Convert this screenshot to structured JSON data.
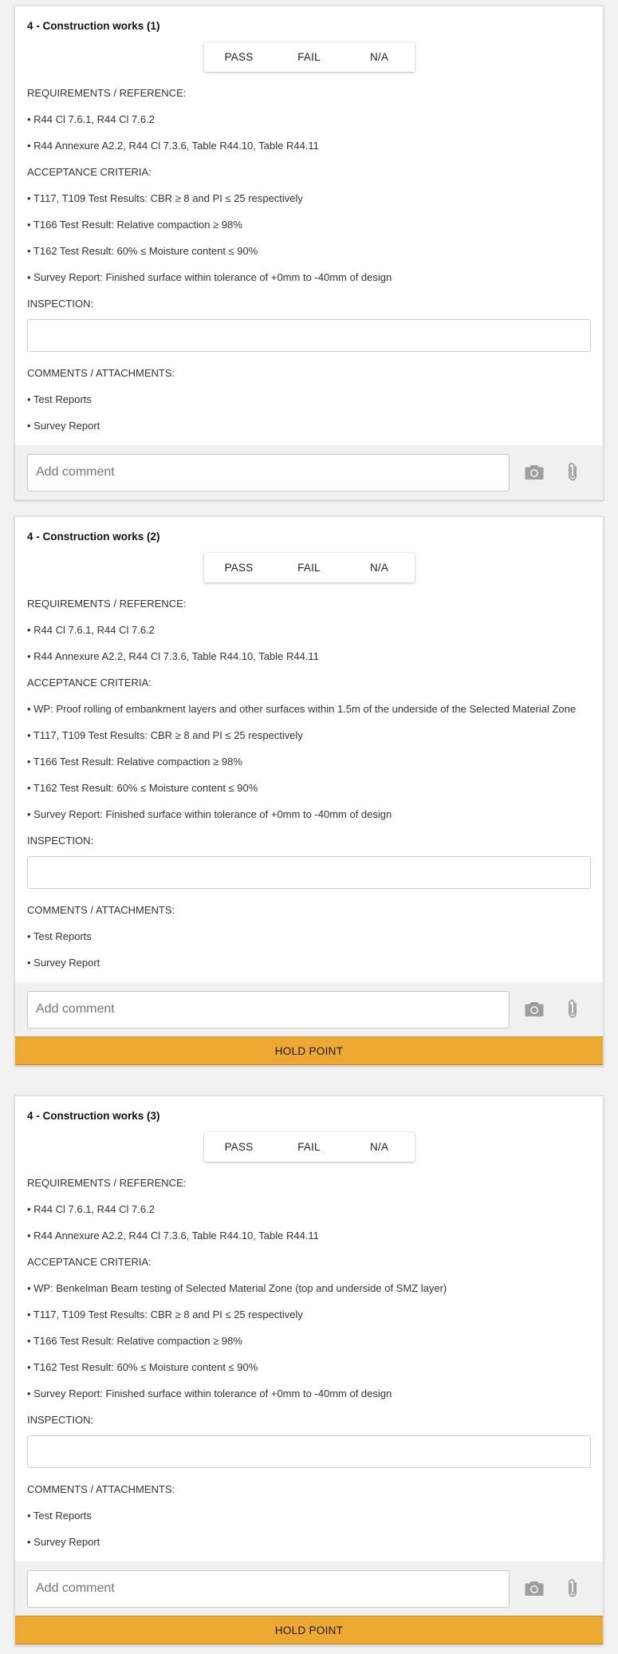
{
  "cards": [
    {
      "title": "4 - Construction works (1)",
      "options": [
        "PASS",
        "FAIL",
        "N/A"
      ],
      "requirements_heading": "REQUIREMENTS / REFERENCE:",
      "requirements": [
        "• R44 Cl 7.6.1, R44 Cl 7.6.2",
        "• R44 Annexure A2.2, R44 Cl 7.3.6, Table R44.10, Table R44.11"
      ],
      "acceptance_heading": "ACCEPTANCE CRITERIA:",
      "acceptance": [
        "• T117, T109 Test Results: CBR ≥ 8 and PI ≤ 25 respectively",
        "• T166 Test Result: Relative compaction ≥ 98%",
        "• T162 Test Result: 60% ≤ Moisture content ≤ 90%",
        "• Survey Report: Finished surface within tolerance of +0mm to -40mm of design"
      ],
      "inspection_heading": "INSPECTION:",
      "comments_heading": "COMMENTS / ATTACHMENTS:",
      "comments": [
        "• Test Reports",
        "• Survey Report"
      ],
      "comment_placeholder": "Add comment",
      "camera_icon": "camera-icon",
      "attach_icon": "paperclip-icon"
    },
    {
      "title": "4 - Construction works (2)",
      "options": [
        "PASS",
        "FAIL",
        "N/A"
      ],
      "requirements_heading": "REQUIREMENTS / REFERENCE:",
      "requirements": [
        "• R44 Cl 7.6.1, R44 Cl 7.6.2",
        "• R44 Annexure A2.2, R44 Cl 7.3.6, Table R44.10, Table R44.11"
      ],
      "acceptance_heading": "ACCEPTANCE CRITERIA:",
      "acceptance": [
        "• WP: Proof rolling of embankment layers and other surfaces within 1.5m of the underside of the Selected Material Zone",
        "• T117, T109 Test Results: CBR ≥ 8 and PI ≤ 25 respectively",
        "• T166 Test Result: Relative compaction ≥ 98%",
        "• T162 Test Result: 60% ≤ Moisture content ≤ 90%",
        "• Survey Report: Finished surface within tolerance of +0mm to -40mm of design"
      ],
      "inspection_heading": "INSPECTION:",
      "comments_heading": "COMMENTS / ATTACHMENTS:",
      "comments": [
        "• Test Reports",
        "• Survey Report"
      ],
      "comment_placeholder": "Add comment",
      "camera_icon": "camera-icon",
      "attach_icon": "paperclip-icon",
      "hold_point": "HOLD POINT"
    },
    {
      "title": "4 - Construction works (3)",
      "options": [
        "PASS",
        "FAIL",
        "N/A"
      ],
      "requirements_heading": "REQUIREMENTS / REFERENCE:",
      "requirements": [
        "• R44 Cl 7.6.1, R44 Cl 7.6.2",
        "• R44 Annexure A2.2, R44 Cl 7.3.6, Table R44.10, Table R44.11"
      ],
      "acceptance_heading": "ACCEPTANCE CRITERIA:",
      "acceptance": [
        "• WP: Benkelman Beam testing of Selected Material Zone (top and underside of SMZ layer)",
        "• T117, T109 Test Results: CBR ≥ 8 and PI ≤ 25 respectively",
        "• T166 Test Result: Relative compaction ≥ 98%",
        "• T162 Test Result: 60% ≤ Moisture content ≤ 90%",
        "• Survey Report: Finished surface within tolerance of +0mm to -40mm of design"
      ],
      "inspection_heading": "INSPECTION:",
      "comments_heading": "COMMENTS / ATTACHMENTS:",
      "comments": [
        "• Test Reports",
        "• Survey Report"
      ],
      "comment_placeholder": "Add comment",
      "camera_icon": "camera-icon",
      "attach_icon": "paperclip-icon",
      "hold_point": "HOLD POINT"
    }
  ],
  "colors": {
    "hold_point_bg": "#eda832",
    "icon_gray": "#9e9e9e"
  }
}
